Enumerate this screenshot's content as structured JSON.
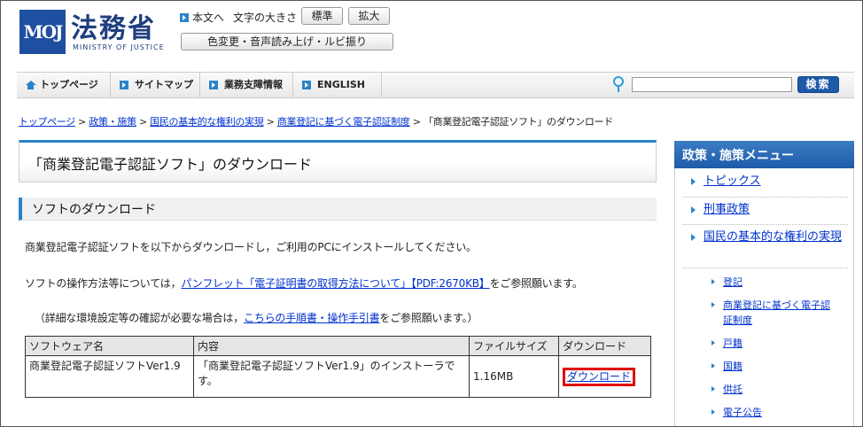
{
  "header": {
    "logo_mark": "MOJ",
    "logo_jp": "法務省",
    "logo_en": "MINISTRY OF JUSTICE",
    "skip_link": "本文へ",
    "font_size_label": "文字の大きさ",
    "font_standard": "標準",
    "font_large": "拡大",
    "accessibility_button": "色変更・音声読み上げ・ルビ振り"
  },
  "nav": {
    "home": "トップページ",
    "sitemap": "サイトマップ",
    "business": "業務支障情報",
    "english": "ENGLISH"
  },
  "search": {
    "value": "",
    "button": "検索"
  },
  "breadcrumb": {
    "items": [
      "トップページ",
      "政策・施策",
      "国民の基本的な権利の実現",
      "商業登記に基づく電子認証制度"
    ],
    "current": "「商業登記電子認証ソフト」のダウンロード",
    "separator": " > "
  },
  "main": {
    "page_title": "「商業登記電子認証ソフト」のダウンロード",
    "section_title": "ソフトのダウンロード",
    "para1": "商業登記電子認証ソフトを以下からダウンロードし，ご利用のPCにインストールしてください。",
    "para2_prefix": "ソフトの操作方法等については，",
    "para2_link": "パンフレット「電子証明書の取得方法について」【PDF:2670KB】",
    "para2_suffix": "をご参照願います。",
    "para3_prefix": "（詳細な環境設定等の確認が必要な場合は，",
    "para3_link": "こちらの手順書・操作手引書",
    "para3_suffix": "をご参照願います。）"
  },
  "table": {
    "headers": [
      "ソフトウェア名",
      "内容",
      "ファイルサイズ",
      "ダウンロード"
    ],
    "row": {
      "name": "商業登記電子認証ソフトVer1.9",
      "description": "「商業登記電子認証ソフトVer1.9」のインストーラです。",
      "size": "1.16MB",
      "download": "ダウンロード"
    }
  },
  "sidebar": {
    "title": "政策・施策メニュー",
    "items": [
      "トピックス",
      "刑事政策",
      "国民の基本的な権利の実現"
    ],
    "sub_items": [
      "登記",
      "商業登記に基づく電子認証制度",
      "戸籍",
      "国籍",
      "供託",
      "電子公告"
    ]
  },
  "colors": {
    "accent": "#2a83c9",
    "brand": "#1e5aa8",
    "highlight_border": "#e10000",
    "link": "#0033cc"
  }
}
